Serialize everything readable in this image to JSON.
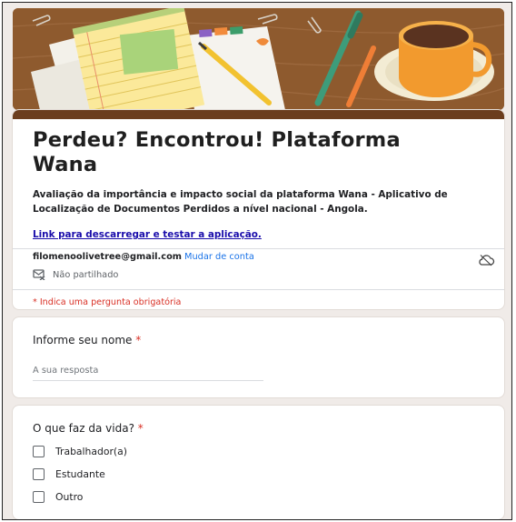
{
  "form": {
    "title": "Perdeu? Encontrou! Plataforma Wana",
    "description": "Avaliação da importância e impacto social da plataforma Wana - Aplicativo de Localização de Documentos Perdidos a nível nacional - Angola.",
    "link_text": "Link para descarregar e testar a aplicação.",
    "account_email": "filomenoolivetree@gmail.com",
    "switch_account": "Mudar de conta",
    "not_shared": "Não partilhado",
    "required_note": "* Indica uma pergunta obrigatória"
  },
  "questions": [
    {
      "label": "Informe seu nome",
      "required_mark": "*",
      "placeholder": "A sua resposta"
    },
    {
      "label": "O que faz da vida?",
      "required_mark": "*",
      "options": [
        "Trabalhador(a)",
        "Estudante",
        "Outro"
      ]
    }
  ],
  "icons": {
    "not_shared": "no-share-icon",
    "cloud": "cloud-offline-icon"
  },
  "colors": {
    "header_bar": "#6b3d1e",
    "link": "#1a0dab",
    "switch_account": "#1a73e8",
    "required": "#d93025"
  }
}
